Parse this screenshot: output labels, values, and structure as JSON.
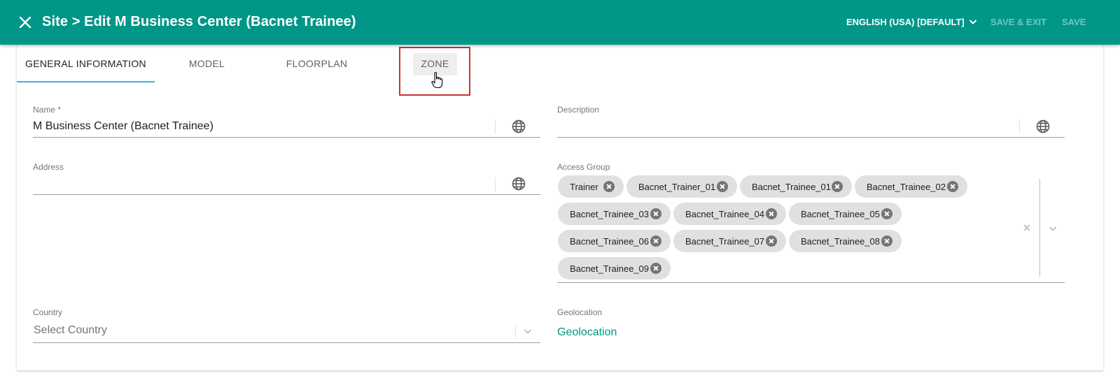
{
  "header": {
    "title": "Site > Edit M Business Center (Bacnet Trainee)",
    "language": "ENGLISH (USA) [DEFAULT]",
    "save_exit_label": "SAVE & EXIT",
    "save_label": "SAVE",
    "background_color": "#009688"
  },
  "tabs": [
    {
      "label": "GENERAL INFORMATION",
      "active": true
    },
    {
      "label": "MODEL",
      "active": false
    },
    {
      "label": "FLOORPLAN",
      "active": false
    },
    {
      "label": "ZONE",
      "active": false,
      "hovered": true
    }
  ],
  "form": {
    "name": {
      "label": "Name *",
      "value": "M Business Center (Bacnet Trainee)"
    },
    "description": {
      "label": "Description",
      "value": ""
    },
    "address": {
      "label": "Address",
      "value": ""
    },
    "access_group": {
      "label": "Access Group",
      "chips": [
        "Trainer",
        "Bacnet_Trainer_01",
        "Bacnet_Trainee_01",
        "Bacnet_Trainee_02",
        "Bacnet_Trainee_03",
        "Bacnet_Trainee_04",
        "Bacnet_Trainee_05",
        "Bacnet_Trainee_06",
        "Bacnet_Trainee_07",
        "Bacnet_Trainee_08",
        "Bacnet_Trainee_09"
      ]
    },
    "country": {
      "label": "Country",
      "placeholder": "Select Country"
    },
    "geolocation": {
      "label": "Geolocation",
      "link": "Geolocation"
    }
  },
  "colors": {
    "accent": "#009688",
    "tab_indicator": "#29b6f6",
    "highlight": "#d32f2f"
  }
}
